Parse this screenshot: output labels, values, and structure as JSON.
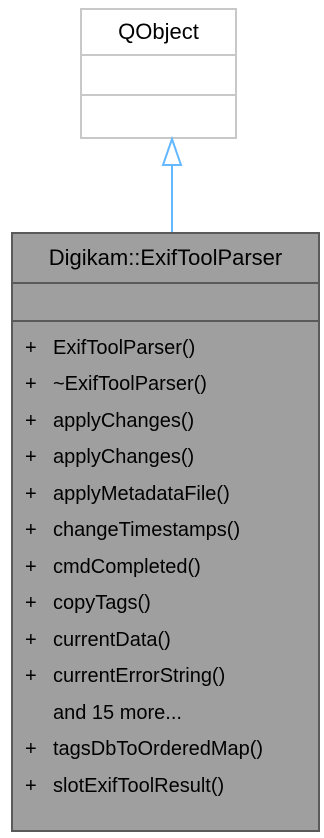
{
  "base_class": {
    "name": "QObject"
  },
  "derived_class": {
    "name": "Digikam::ExifToolParser",
    "operations": [
      {
        "visibility": "+",
        "name": "ExifToolParser()"
      },
      {
        "visibility": "+",
        "name": "~ExifToolParser()"
      },
      {
        "visibility": "+",
        "name": "applyChanges()"
      },
      {
        "visibility": "+",
        "name": "applyChanges()"
      },
      {
        "visibility": "+",
        "name": "applyMetadataFile()"
      },
      {
        "visibility": "+",
        "name": "changeTimestamps()"
      },
      {
        "visibility": "+",
        "name": "cmdCompleted()"
      },
      {
        "visibility": "+",
        "name": "copyTags()"
      },
      {
        "visibility": "+",
        "name": "currentData()"
      },
      {
        "visibility": "+",
        "name": "currentErrorString()"
      },
      {
        "visibility": "",
        "name": "and 15 more..."
      },
      {
        "visibility": "+",
        "name": "tagsDbToOrderedMap()"
      },
      {
        "visibility": "+",
        "name": "slotExifToolResult()"
      }
    ]
  },
  "colors": {
    "arrow": "#63b8ff",
    "derived_fill": "#9f9f9f",
    "derived_border": "#5a5a5a",
    "base_border": "#c8c8c8"
  }
}
